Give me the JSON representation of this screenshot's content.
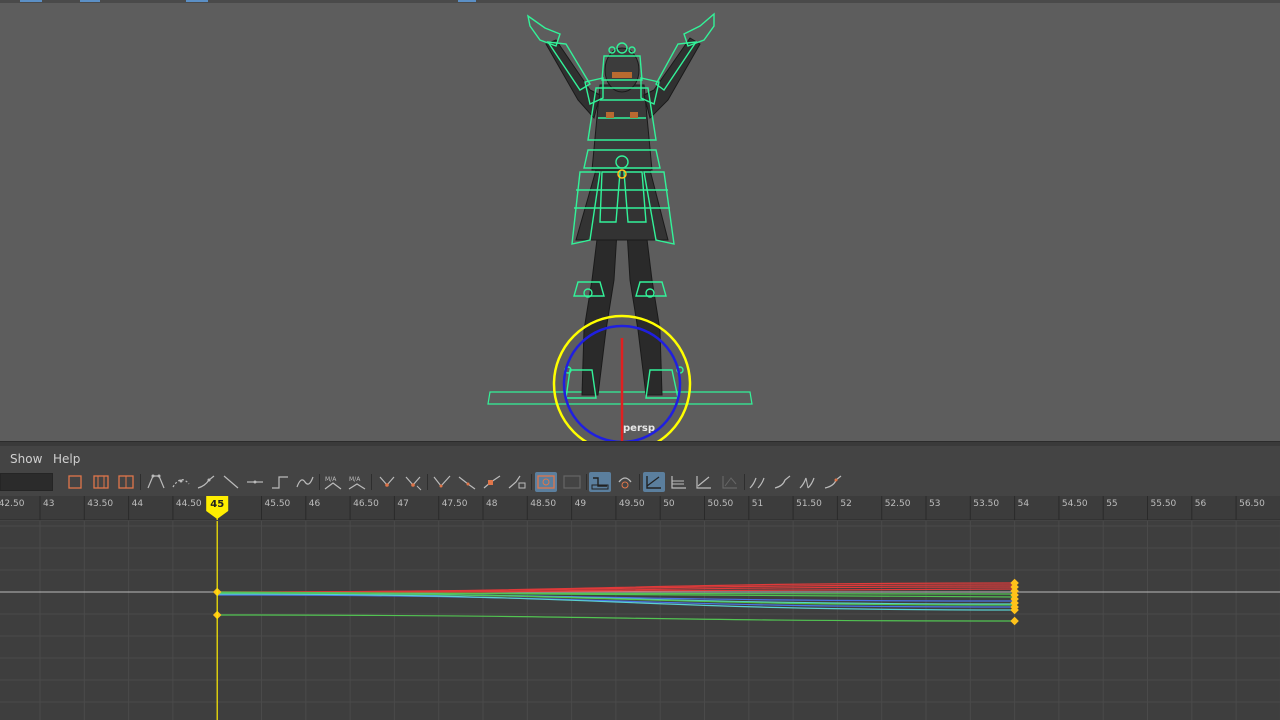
{
  "viewport": {
    "camera_label": "persp",
    "tab_color": "#5b8fc5",
    "rig_color": "#33f299",
    "manipulator_colors": {
      "ring_outer": "#ffff00",
      "ring_inner": "#1f1fe0",
      "axis": "#e02020"
    }
  },
  "graph_editor": {
    "menu": {
      "show": "Show",
      "help": "Help"
    },
    "toolbar": {
      "icons": [
        "move-key-icon",
        "insert-key-icon",
        "add-key-icon",
        "lattice-deform-icon",
        "region-tool-icon",
        "retime-tool-icon",
        "auto-tangent-icon",
        "spline-tangent-icon",
        "clamped-tangent-icon",
        "linear-tangent-icon",
        "flat-tangent-icon",
        "step-tangent-icon",
        "plateau-tangent-icon",
        "break-tangents-icon",
        "unify-tangents-icon",
        "free-tangent-weight-icon",
        "lock-tangent-weight-icon",
        "normalize-icon",
        "denormalize-icon",
        "buffer-curve-snapshot-icon",
        "swap-buffer-curves-icon",
        "auto-load-icon",
        "curve-pin-icon",
        "stacked-curves-icon",
        "show-normalized-icon",
        "infinity-cycle-icon",
        "pre-infinity-icon",
        "post-infinity-icon",
        "cycle-with-offset-icon"
      ]
    },
    "ruler": {
      "labels": [
        "42.50",
        "43",
        "43.50",
        "44",
        "44.50",
        "45.50",
        "46",
        "46.50",
        "47",
        "47.50",
        "48",
        "48.50",
        "49",
        "49.50",
        "50",
        "50.50",
        "51",
        "51.50",
        "52",
        "52.50",
        "53",
        "53.50",
        "54",
        "54.50",
        "55",
        "55.50",
        "56",
        "56.50"
      ],
      "current_frame": "45"
    },
    "colors": {
      "current_time": "#ffee00",
      "key_selected": "#ffc21a",
      "curve_red": "#e03a3a",
      "curve_green": "#52c452",
      "curve_blue": "#4a74e8",
      "curve_cyan": "#5ad0d0"
    }
  }
}
